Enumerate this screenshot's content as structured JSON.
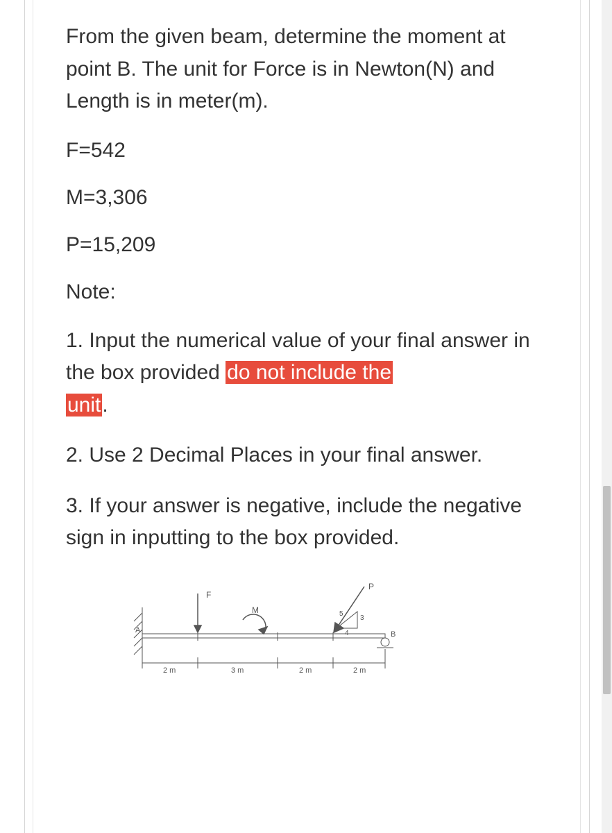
{
  "question": "From the given beam, determine the moment at point B. The unit for Force is in Newton(N) and Length is in meter(m).",
  "given": {
    "F": "F=542",
    "M": "M=3,306",
    "P": "P=15,209"
  },
  "note_label": "Note:",
  "notes": {
    "n1_pre": "1. Input the numerical value of your final answer in the box provided ",
    "n1_hl_a": "do not include the",
    "n1_hl_b": "unit",
    "n1_post": ".",
    "n2": "2. Use 2 Decimal Places in your final answer.",
    "n3": "3. If your answer is negative, include the negative sign in inputting to the box provided."
  },
  "diagram": {
    "labels": {
      "A": "A",
      "B": "B",
      "F": "F",
      "M": "M",
      "P": "P",
      "slope_v": "3",
      "slope_h": "4",
      "slope_hyp": "5",
      "d1": "2 m",
      "d2": "3 m",
      "d3": "2 m",
      "d4": "2 m"
    }
  }
}
